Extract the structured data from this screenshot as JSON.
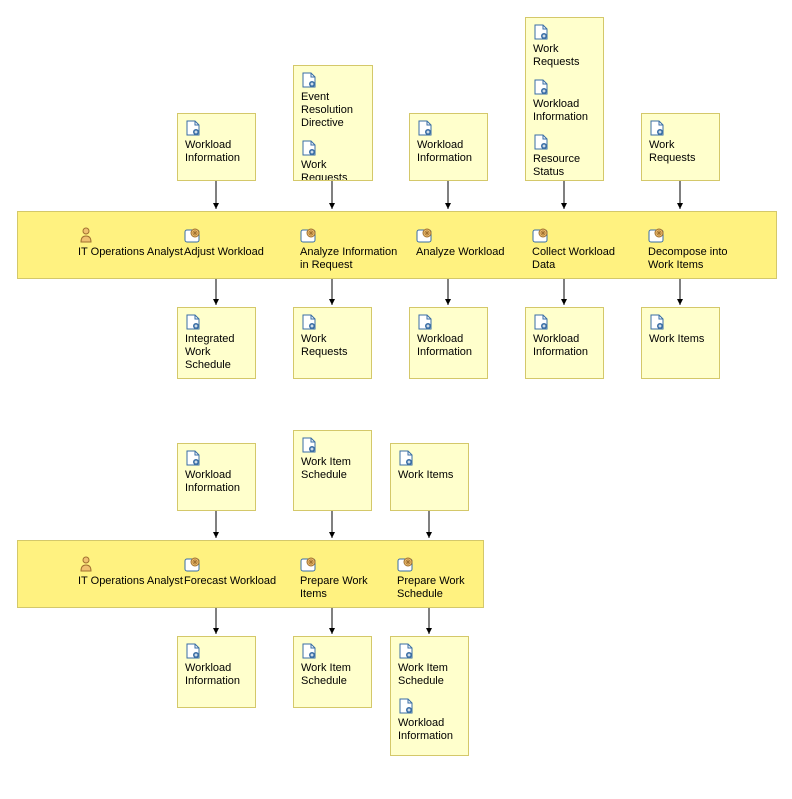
{
  "lane_label_1": "IT Operations Analyst",
  "lane_label_2": "IT Operations Analyst",
  "col1_in": "Workload Information",
  "col2_in_a": "Event Resolution Directive",
  "col2_in_b": "Work Requests",
  "col3_in": "Workload Information",
  "col4_in_a": "Work Requests",
  "col4_in_b": "Workload Information",
  "col4_in_c": "Resource Status",
  "col5_in": "Work Requests",
  "proc1": "Adjust Workload",
  "proc2": "Analyze Information in Request",
  "proc3": "Analyze Workload",
  "proc4": "Collect Workload Data",
  "proc5": "Decompose into Work Items",
  "out1": "Integrated Work Schedule",
  "out2": "Work Requests",
  "out3": "Workload Information",
  "out4": "Workload Information",
  "out5": "Work Items",
  "b_col1_in": "Workload Information",
  "b_col2_in": "Work Item Schedule",
  "b_col3_in": "Work Items",
  "b_proc1": "Forecast Workload",
  "b_proc2": "Prepare Work Items",
  "b_proc3": "Prepare Work Schedule",
  "b_out1": "Workload Information",
  "b_out2": "Work Item Schedule",
  "b_out3a": "Work Item Schedule",
  "b_out3b": "Workload Information"
}
